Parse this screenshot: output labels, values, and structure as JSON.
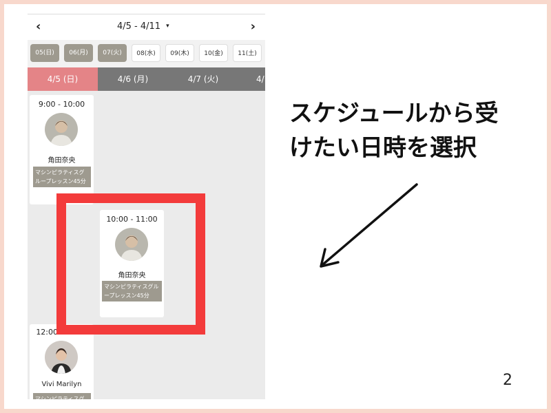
{
  "phone": {
    "week_range": "4/5 - 4/11",
    "prev_icon": "‹",
    "next_icon": "›",
    "caret_icon": "▾",
    "day_chips": [
      "05(日)",
      "06(月)",
      "07(火)",
      "08(水)",
      "09(木)",
      "10(金)",
      "11(土)"
    ],
    "dates": [
      "4/5 (日)",
      "4/6 (月)",
      "4/7 (火)",
      "4/"
    ],
    "lessons": [
      {
        "time": "9:00 - 10:00",
        "instructor": "角田奈央",
        "lesson": "マシンピラティスグループレッスン45分"
      },
      {
        "time": "10:00 - 11:00",
        "instructor": "角田奈央",
        "lesson": "マシンピラティスグループレッスン45分"
      },
      {
        "time": "12:00 - 13:00",
        "instructor": "Vivi Marilyn",
        "lesson": "マシンピラティスグ"
      }
    ]
  },
  "instruction": {
    "line1": "スケジュールから受",
    "line2": "けたい日時を選択"
  },
  "page_number": "2",
  "colors": {
    "accent_pink": "#e48487",
    "chip_past": "#9e9a8f",
    "highlight_red": "#f33b3b",
    "border_peach": "#f8d8cc"
  }
}
